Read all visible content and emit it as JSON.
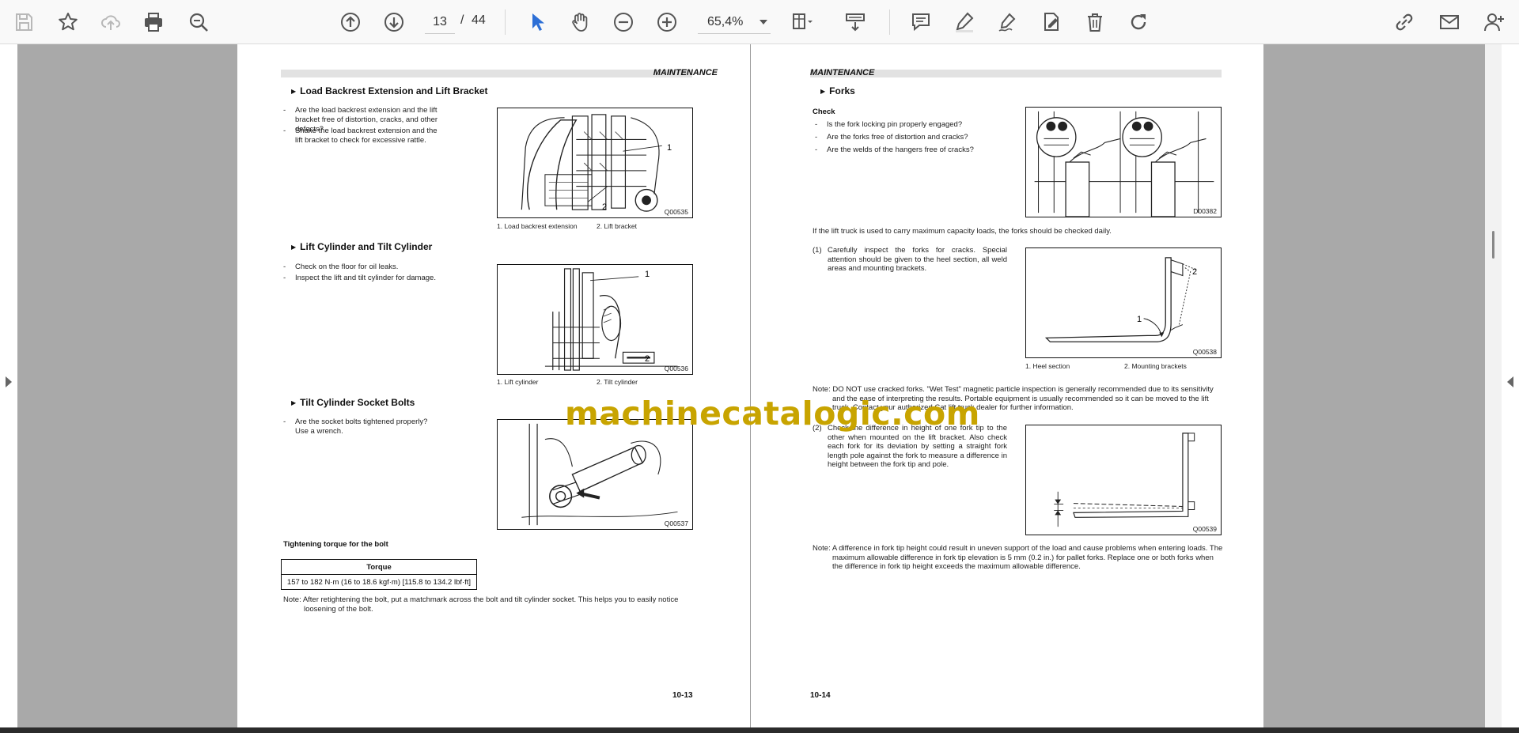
{
  "toolbar": {
    "current_page": "13",
    "slash": "/",
    "total_pages": "44",
    "zoom": "65,4%",
    "icons": [
      "save-icon",
      "bookmark-star-icon",
      "cloud-upload-icon",
      "print-icon",
      "zoom-search-icon",
      "page-up-icon",
      "page-down-icon",
      "select-cursor-icon",
      "hand-pan-icon",
      "zoom-out-icon",
      "zoom-in-icon",
      "fit-page-icon",
      "scroll-mode-icon",
      "comment-icon",
      "highlight-pen-icon",
      "sign-icon",
      "edit-page-icon",
      "delete-icon",
      "rotate-icon",
      "link-icon",
      "email-icon",
      "add-user-icon"
    ],
    "accent": "#2d6fd6"
  },
  "left_page": {
    "header": "MAINTENANCE",
    "section1": {
      "title": "Load Backrest Extension and Lift Bracket",
      "bullets": [
        "Are the load backrest extension and the lift bracket free of distortion, cracks, and other defects?",
        "Shake the load backrest extension and the lift bracket to check for excessive rattle."
      ],
      "figure_code": "Q00535",
      "callouts": [
        "1",
        "2"
      ],
      "captions": [
        "1. Load backrest extension",
        "2. Lift bracket"
      ]
    },
    "section2": {
      "title": "Lift Cylinder and Tilt Cylinder",
      "bullets": [
        "Check on the floor for oil leaks.",
        "Inspect the lift and tilt cylinder for damage."
      ],
      "figure_code": "Q00536",
      "callouts": [
        "1",
        "2"
      ],
      "captions": [
        "1. Lift cylinder",
        "2. Tilt cylinder"
      ]
    },
    "section3": {
      "title": "Tilt Cylinder Socket Bolts",
      "bullets": [
        "Are the socket bolts tightened properly? Use a wrench."
      ],
      "figure_code": "Q00537"
    },
    "torque": {
      "heading": "Tightening torque for the bolt",
      "column": "Torque",
      "value": "157 to 182 N·m (16 to 18.6 kgf·m) [115.8 to 134.2 lbf·ft]",
      "note": "Note: After retightening the bolt, put a matchmark across the bolt and tilt cylinder socket. This helps you to easily notice loosening of the bolt."
    },
    "page_number": "10-13"
  },
  "right_page": {
    "header": "MAINTENANCE",
    "section_title": "Forks",
    "check_heading": "Check",
    "check_bullets": [
      "Is the fork locking pin properly engaged?",
      "Are the forks free of distortion and cracks?",
      "Are the welds of the hangers free of cracks?"
    ],
    "figure1_code": "D00382",
    "daily_text": "If the lift truck is used to carry maximum capacity loads, the forks should be checked daily.",
    "item1_num": "(1)",
    "item1_text": "Carefully inspect the forks for cracks. Special attention should be given to the heel section, all weld areas and mounting brackets.",
    "figure2_code": "Q00538",
    "figure2_callouts": [
      "1",
      "2"
    ],
    "figure2_captions": [
      "1. Heel section",
      "2. Mounting brackets"
    ],
    "note1": "Note: DO NOT use cracked forks. \"Wet Test\" magnetic particle inspection is generally recommended due to its sensitivity and the ease of interpreting the results. Portable equipment is usually recommended so it can be moved to the lift truck. Contact your authorized Cat lift truck dealer for further information.",
    "item2_num": "(2)",
    "item2_text": "Check the difference in height of one fork tip to the other when mounted on the lift bracket. Also check each fork for its deviation by setting a straight fork length pole against the fork to measure a difference in height between the fork tip and pole.",
    "figure3_code": "Q00539",
    "note2": "Note: A difference in fork tip height could result in uneven support of the load and cause problems when entering loads. The maximum allowable difference in fork tip elevation is 5 mm (0.2 in.) for pallet forks. Replace one or both forks when the difference in fork tip height exceeds the maximum allowable difference.",
    "page_number": "10-14"
  },
  "watermark": "machinecatalogic.com"
}
